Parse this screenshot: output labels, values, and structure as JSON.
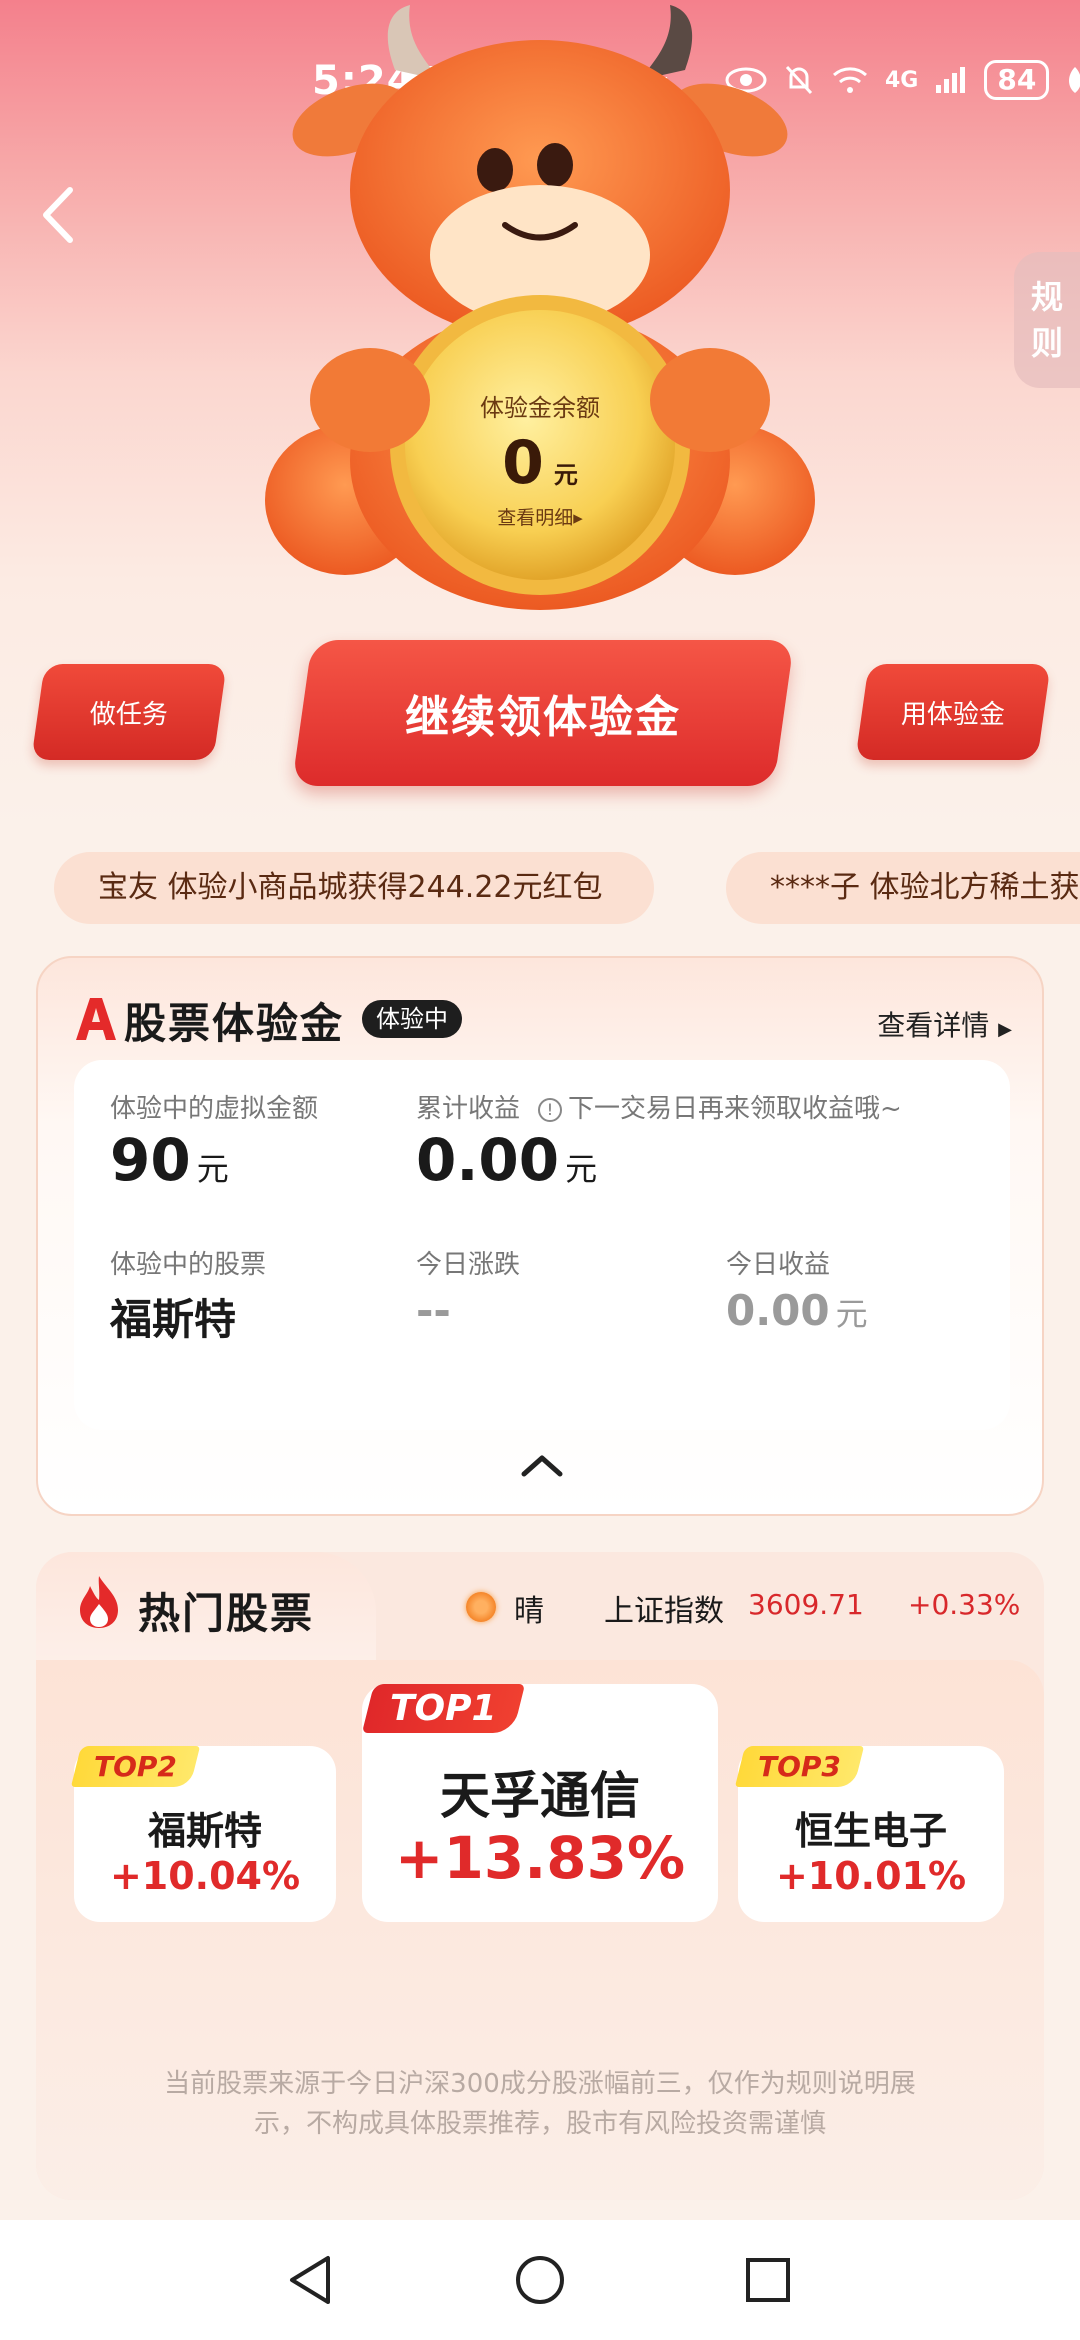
{
  "status_bar": {
    "time": "5:24",
    "more": "···",
    "network": "4G",
    "battery": "84",
    "app_icons": [
      "app-icon-1",
      "app-icon-2",
      "play-icon",
      "app-icon-3",
      "music-icon"
    ]
  },
  "header": {
    "rules_tab": [
      "规",
      "则"
    ]
  },
  "coin": {
    "label": "体验金余额",
    "amount": "0",
    "unit": "元",
    "detail_link": "查看明细▸"
  },
  "actions": {
    "do_tasks": "做任务",
    "main": "继续领体验金",
    "use_fund": "用体验金"
  },
  "ticker": [
    "宝友 体验小商品城获得244.22元红包",
    "****子 体验北方稀土获"
  ],
  "experience_card": {
    "title": "股票体验金",
    "badge": "体验中",
    "detail_link": "查看详情",
    "virtual_amount_label": "体验中的虚拟金额",
    "virtual_amount": "90",
    "virtual_amount_unit": "元",
    "cumulative_label": "累计收益",
    "cumulative_tip": "下一交易日再来领取收益哦~",
    "cumulative_value": "0.00",
    "cumulative_unit": "元",
    "stock_label": "体验中的股票",
    "stock_name": "福斯特",
    "today_change_label": "今日涨跌",
    "today_change": "--",
    "today_income_label": "今日收益",
    "today_income": "0.00",
    "today_income_unit": "元"
  },
  "hot_stocks": {
    "title": "热门股票",
    "weather": "晴",
    "index_name": "上证指数",
    "index_value": "3609.71",
    "index_change": "+0.33%",
    "top1": {
      "tag": "TOP1",
      "name": "天孚通信",
      "change": "+13.83%"
    },
    "top2": {
      "tag": "TOP2",
      "name": "福斯特",
      "change": "+10.04%"
    },
    "top3": {
      "tag": "TOP3",
      "name": "恒生电子",
      "change": "+10.01%"
    },
    "disclaimer_line1": "当前股票来源于今日沪深300成分股涨幅前三，仅作为规则说明展",
    "disclaimer_line2": "示，不构成具体股票推荐，股市有风险投资需谨慎"
  },
  "colors": {
    "accent_red": "#dd2b2b",
    "up_red": "#e02a2a",
    "top_yellow": "#ffd93a"
  }
}
